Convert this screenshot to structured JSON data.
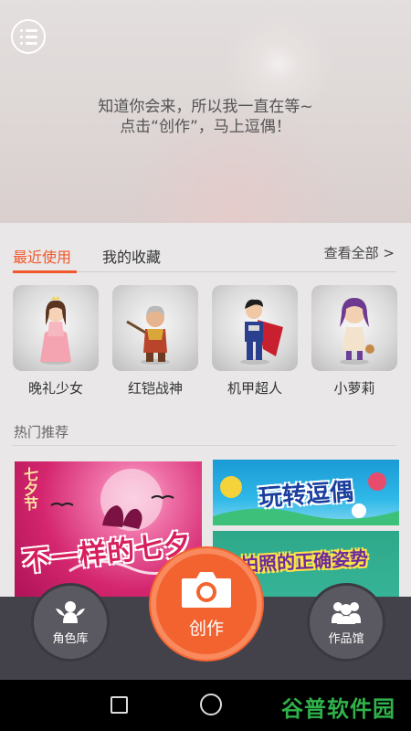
{
  "hero": {
    "menu_icon": "list-icon",
    "line1": "知道你会来，所以我一直在等~",
    "line2": "点击“创作”，马上逗偶！"
  },
  "tabs": {
    "recent": "最近使用",
    "favorites": "我的收藏",
    "see_all": "查看全部 >",
    "accent": "#f0582b"
  },
  "characters": [
    {
      "label": "晚礼少女",
      "icon": "girl-evening-dress-avatar"
    },
    {
      "label": "红铠战神",
      "icon": "warrior-avatar"
    },
    {
      "label": "机甲超人",
      "icon": "superhero-avatar"
    },
    {
      "label": "小萝莉",
      "icon": "little-girl-avatar"
    }
  ],
  "hot": {
    "title": "热门推荐",
    "banner1": {
      "title": "不一样的七夕",
      "side": "七夕节"
    },
    "banner2": {
      "title": "玩转逗偶"
    },
    "banner3": {
      "title": "自拍照的正确姿势"
    }
  },
  "bottom": {
    "left_label": "角色库",
    "center_label": "创作",
    "right_label": "作品馆",
    "left_icon": "winged-character-icon",
    "center_icon": "camera-icon",
    "right_icon": "people-group-icon"
  },
  "watermark": "谷普软件园"
}
